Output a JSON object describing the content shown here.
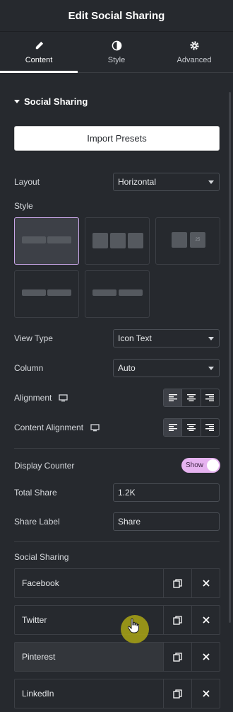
{
  "header": {
    "title": "Edit Social Sharing"
  },
  "tabs": [
    {
      "label": "Content",
      "icon": "pencil-icon",
      "active": true
    },
    {
      "label": "Style",
      "icon": "contrast-icon",
      "active": false
    },
    {
      "label": "Advanced",
      "icon": "gear-icon",
      "active": false
    }
  ],
  "section": {
    "title": "Social Sharing"
  },
  "import_button": {
    "label": "Import Presets"
  },
  "fields": {
    "layout": {
      "label": "Layout",
      "value": "Horizontal"
    },
    "style": {
      "label": "Style"
    },
    "view_type": {
      "label": "View Type",
      "value": "Icon Text"
    },
    "column": {
      "label": "Column",
      "value": "Auto"
    },
    "alignment": {
      "label": "Alignment"
    },
    "content_alignment": {
      "label": "Content Alignment"
    },
    "display_counter": {
      "label": "Display Counter",
      "toggle_text": "Show",
      "enabled": true
    },
    "total_share": {
      "label": "Total Share",
      "value": "1.2K"
    },
    "share_label": {
      "label": "Share Label",
      "value": "Share"
    }
  },
  "social_list": {
    "label": "Social Sharing",
    "items": [
      {
        "label": "Facebook"
      },
      {
        "label": "Twitter"
      },
      {
        "label": "Pinterest"
      },
      {
        "label": "LinkedIn"
      }
    ]
  },
  "style_presets": {
    "preset2_counter": "25"
  },
  "colors": {
    "accent": "#e6b3f0",
    "selected_border": "#c9a6e8",
    "cursor": "#aaa514"
  }
}
